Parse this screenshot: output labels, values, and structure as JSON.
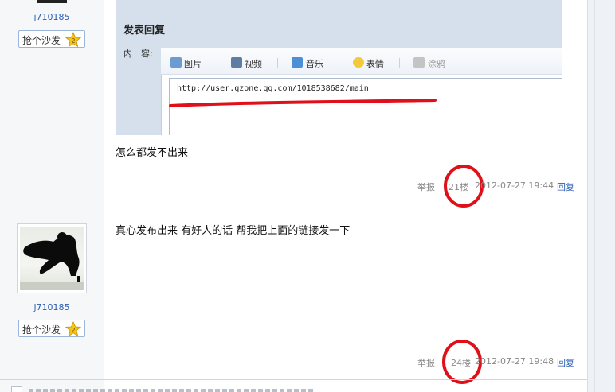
{
  "posts": [
    {
      "username": "j710185",
      "sofa_label": "抢个沙发",
      "embedded_screenshot": {
        "title": "发表回复",
        "content_label": "内　容:",
        "toolbar": [
          "图片",
          "视频",
          "音乐",
          "表情",
          "涂鸦"
        ],
        "url_text": "http://user.qzone.qq.com/1018538682/main"
      },
      "body": "怎么都发不出来",
      "report": "举报",
      "floor": "21楼",
      "timestamp": "2012-07-27 19:44",
      "reply": "回复"
    },
    {
      "username": "j710185",
      "sofa_label": "抢个沙发",
      "body": "真心发布出来 有好人的话 帮我把上面的链接发一下",
      "report": "举报",
      "floor": "24楼",
      "timestamp": "2012-07-27 19:48",
      "reply": "回复"
    }
  ],
  "colors": {
    "link": "#2a5db0",
    "annotation_red": "#e0101a",
    "left_panel": "#f6f7f9"
  }
}
